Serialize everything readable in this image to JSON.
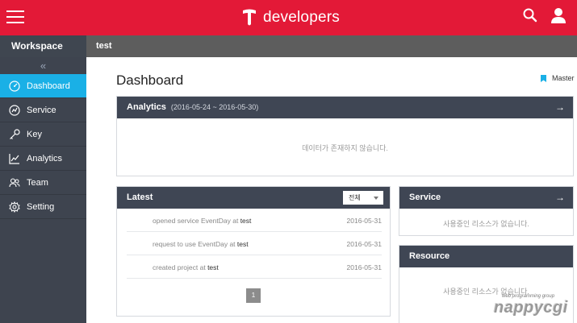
{
  "header": {
    "brand": "developers",
    "brand_color": "#e31937"
  },
  "subbar": {
    "workspace": "Workspace",
    "project": "test"
  },
  "sidebar": {
    "collapse": "«",
    "items": [
      {
        "label": "Dashboard",
        "icon": "dashboard-icon",
        "active": true
      },
      {
        "label": "Service",
        "icon": "service-icon"
      },
      {
        "label": "Key",
        "icon": "key-icon"
      },
      {
        "label": "Analytics",
        "icon": "analytics-icon"
      },
      {
        "label": "Team",
        "icon": "team-icon"
      },
      {
        "label": "Setting",
        "icon": "gear-icon"
      }
    ],
    "active_color": "#1ab0e6"
  },
  "main": {
    "title": "Dashboard",
    "master": "Master",
    "analytics": {
      "title": "Analytics",
      "range": "(2016-05-24 ~ 2016-05-30)",
      "empty": "데이터가 존재하지 않습니다."
    },
    "latest": {
      "title": "Latest",
      "filter": "전체",
      "rows": [
        {
          "text": "opened service EventDay at",
          "target": "test",
          "date": "2016-05-31"
        },
        {
          "text": "request to use EventDay at",
          "target": "test",
          "date": "2016-05-31"
        },
        {
          "text": "created project at",
          "target": "test",
          "date": "2016-05-31"
        }
      ],
      "page": "1"
    },
    "service": {
      "title": "Service",
      "empty": "사용중인 리소스가 없습니다."
    },
    "resource": {
      "title": "Resource",
      "empty": "사용중인 리소스가 없습니다."
    }
  },
  "watermark": {
    "small": "web programming group",
    "big": "nappycgi"
  }
}
